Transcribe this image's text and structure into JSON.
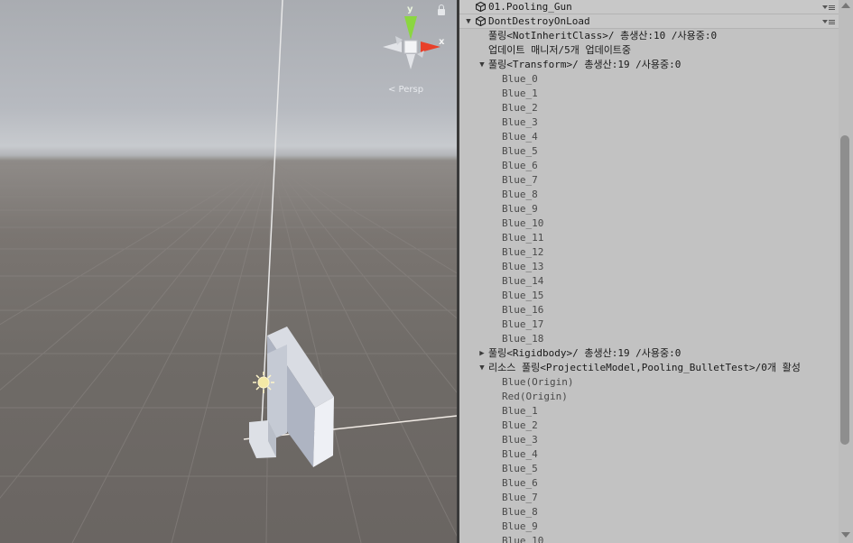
{
  "scene_view": {
    "persp_label": "< Persp",
    "gizmo": {
      "y_label": "y",
      "x_label": "x"
    }
  },
  "hierarchy": {
    "rows": [
      {
        "indent": 0,
        "text": "01.Pooling_Gun",
        "arrow": "",
        "icon": "unity-scene-icon",
        "scene": true
      },
      {
        "indent": 0,
        "text": "DontDestroyOnLoad",
        "arrow": "▼",
        "icon": "unity-scene-icon",
        "scene": true
      },
      {
        "indent": 1,
        "text": "풀링<NotInheritClass>/ 총생산:10 /사용중:0",
        "arrow": ""
      },
      {
        "indent": 1,
        "text": "업데이트 매니저/5개 업데이트중",
        "arrow": ""
      },
      {
        "indent": 1,
        "text": "풀링<Transform>/ 총생산:19 /사용중:0",
        "arrow": "▼"
      },
      {
        "indent": 2,
        "text": "Blue_0",
        "arrow": "",
        "dim": true
      },
      {
        "indent": 2,
        "text": "Blue_1",
        "arrow": "",
        "dim": true
      },
      {
        "indent": 2,
        "text": "Blue_2",
        "arrow": "",
        "dim": true
      },
      {
        "indent": 2,
        "text": "Blue_3",
        "arrow": "",
        "dim": true
      },
      {
        "indent": 2,
        "text": "Blue_4",
        "arrow": "",
        "dim": true
      },
      {
        "indent": 2,
        "text": "Blue_5",
        "arrow": "",
        "dim": true
      },
      {
        "indent": 2,
        "text": "Blue_6",
        "arrow": "",
        "dim": true
      },
      {
        "indent": 2,
        "text": "Blue_7",
        "arrow": "",
        "dim": true
      },
      {
        "indent": 2,
        "text": "Blue_8",
        "arrow": "",
        "dim": true
      },
      {
        "indent": 2,
        "text": "Blue_9",
        "arrow": "",
        "dim": true
      },
      {
        "indent": 2,
        "text": "Blue_10",
        "arrow": "",
        "dim": true
      },
      {
        "indent": 2,
        "text": "Blue_11",
        "arrow": "",
        "dim": true
      },
      {
        "indent": 2,
        "text": "Blue_12",
        "arrow": "",
        "dim": true
      },
      {
        "indent": 2,
        "text": "Blue_13",
        "arrow": "",
        "dim": true
      },
      {
        "indent": 2,
        "text": "Blue_14",
        "arrow": "",
        "dim": true
      },
      {
        "indent": 2,
        "text": "Blue_15",
        "arrow": "",
        "dim": true
      },
      {
        "indent": 2,
        "text": "Blue_16",
        "arrow": "",
        "dim": true
      },
      {
        "indent": 2,
        "text": "Blue_17",
        "arrow": "",
        "dim": true
      },
      {
        "indent": 2,
        "text": "Blue_18",
        "arrow": "",
        "dim": true
      },
      {
        "indent": 1,
        "text": "풀링<Rigidbody>/ 총생산:19 /사용중:0",
        "arrow": "▶"
      },
      {
        "indent": 1,
        "text": "리소스 풀링<ProjectileModel,Pooling_BulletTest>/0개 활성",
        "arrow": "▼"
      },
      {
        "indent": 2,
        "text": "Blue(Origin)",
        "arrow": "",
        "dim": true
      },
      {
        "indent": 2,
        "text": "Red(Origin)",
        "arrow": "",
        "dim": true
      },
      {
        "indent": 2,
        "text": "Blue_1",
        "arrow": "",
        "dim": true
      },
      {
        "indent": 2,
        "text": "Blue_2",
        "arrow": "",
        "dim": true
      },
      {
        "indent": 2,
        "text": "Blue_3",
        "arrow": "",
        "dim": true
      },
      {
        "indent": 2,
        "text": "Blue_4",
        "arrow": "",
        "dim": true
      },
      {
        "indent": 2,
        "text": "Blue_5",
        "arrow": "",
        "dim": true
      },
      {
        "indent": 2,
        "text": "Blue_6",
        "arrow": "",
        "dim": true
      },
      {
        "indent": 2,
        "text": "Blue_7",
        "arrow": "",
        "dim": true
      },
      {
        "indent": 2,
        "text": "Blue_8",
        "arrow": "",
        "dim": true
      },
      {
        "indent": 2,
        "text": "Blue_9",
        "arrow": "",
        "dim": true
      },
      {
        "indent": 2,
        "text": "Blue_10",
        "arrow": "",
        "dim": true
      }
    ]
  },
  "colors": {
    "gizmo_y": "#8bd640",
    "gizmo_x": "#e8402a",
    "panel_bg": "#c2c2c2"
  }
}
